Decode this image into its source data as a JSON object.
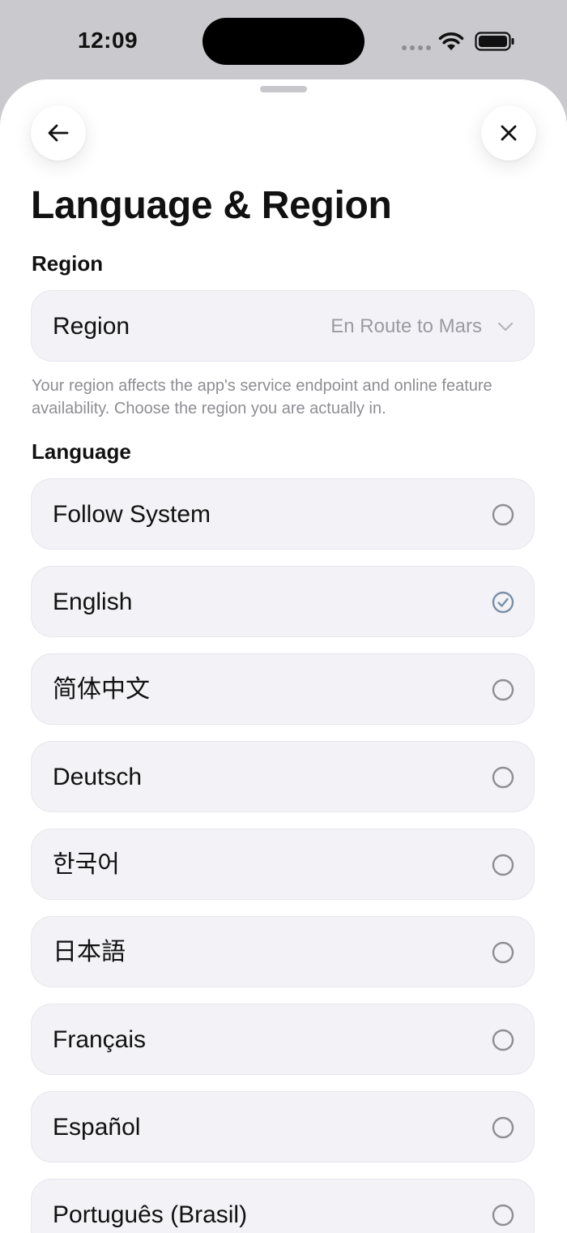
{
  "status_bar": {
    "time": "12:09"
  },
  "header": {
    "back_icon": "arrow-left-icon",
    "close_icon": "close-icon",
    "title": "Language & Region"
  },
  "region_section": {
    "heading": "Region",
    "row_label": "Region",
    "row_value": "En Route to Mars",
    "helper_text": "Your region affects the app's service endpoint and online feature availability. Choose the region you are actually in."
  },
  "language_section": {
    "heading": "Language",
    "options": [
      {
        "label": "Follow System",
        "selected": false
      },
      {
        "label": "English",
        "selected": true
      },
      {
        "label": "简体中文",
        "selected": false
      },
      {
        "label": "Deutsch",
        "selected": false
      },
      {
        "label": "한국어",
        "selected": false
      },
      {
        "label": "日本語",
        "selected": false
      },
      {
        "label": "Français",
        "selected": false
      },
      {
        "label": "Español",
        "selected": false
      },
      {
        "label": "Português (Brasil)",
        "selected": false
      }
    ]
  },
  "colors": {
    "background_gray": "#c9c9ce",
    "row_fill": "#f2f2f7",
    "checked_accent": "#7a8fa8",
    "unchecked_ring": "#8e8e93",
    "secondary_text": "#8e8e93"
  }
}
